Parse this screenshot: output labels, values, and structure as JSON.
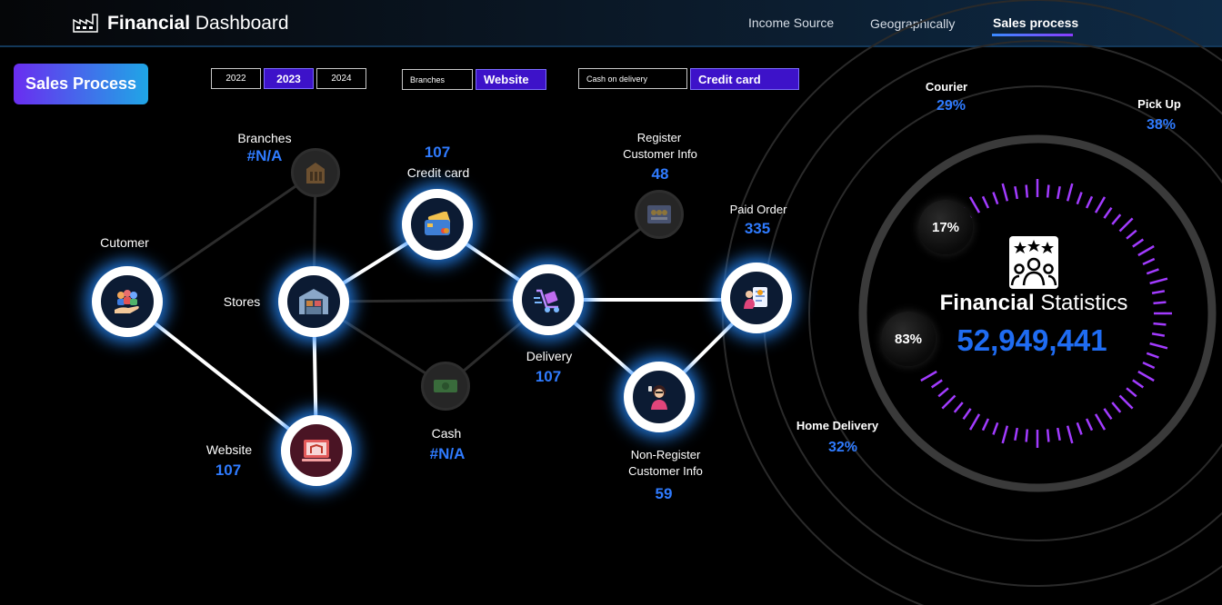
{
  "header": {
    "title_bold": "Financial",
    "title_rest": " Dashboard",
    "icon": "factory-icon",
    "nav": [
      {
        "label": "Income Source",
        "active": false
      },
      {
        "label": "Geographically",
        "active": false
      },
      {
        "label": "Sales process",
        "active": true
      }
    ]
  },
  "badge": "Sales Process",
  "filters": {
    "years": [
      "2022",
      "2023",
      "2024"
    ],
    "selected_year": "2023",
    "channels": [
      "Branches",
      "Website"
    ],
    "selected_channel": "Website",
    "payments": [
      "Cash on delivery",
      "Credit card"
    ],
    "selected_payment": "Credit card"
  },
  "flow": {
    "customer": {
      "label": "Cutomer",
      "icon": "customer-hand-icon"
    },
    "stores": {
      "label": "Stores",
      "icon": "store-icon"
    },
    "branches": {
      "label": "Branches",
      "value": "#N/A",
      "icon": "building-icon"
    },
    "website": {
      "label": "Website",
      "value": "107",
      "icon": "website-icon"
    },
    "credit_card": {
      "label": "Credit card",
      "value": "107",
      "icon": "credit-card-icon"
    },
    "cash": {
      "label": "Cash",
      "value": "#N/A",
      "icon": "cash-icon"
    },
    "delivery": {
      "label": "Delivery",
      "value": "107",
      "icon": "delivery-icon"
    },
    "register": {
      "label_line1": "Register",
      "label_line2": "Customer  Info",
      "value": "48",
      "icon": "register-icon"
    },
    "nonregister": {
      "label_line1": "Non-Register",
      "label_line2": "Customer  Info",
      "value": "59",
      "icon": "person-icon"
    },
    "paid_order": {
      "label": "Paid Order",
      "value": "335",
      "icon": "paid-order-icon"
    }
  },
  "stats": {
    "title_bold": "Financial",
    "title_rest": " Statistics",
    "total": "52,949,441",
    "icon": "rating-people-icon",
    "pct_top": "17%",
    "pct_bottom": "83%",
    "courier": {
      "label": "Courier",
      "value": "29%"
    },
    "pickup": {
      "label": "Pick Up",
      "value": "38%"
    },
    "home_delivery": {
      "label": "Home Delivery",
      "value": "32%"
    }
  },
  "colors": {
    "accent_blue": "#2f7bff",
    "selected_slicer": "#3d12c9",
    "ring_purple": "#a23bff"
  }
}
